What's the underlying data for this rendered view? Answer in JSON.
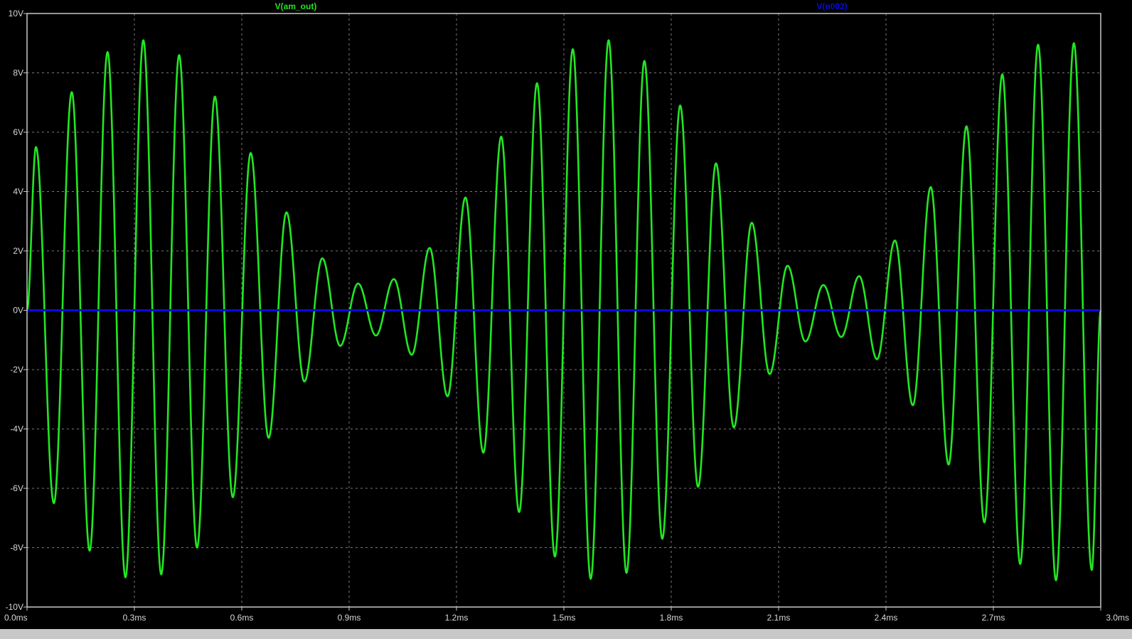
{
  "colors": {
    "background": "#000000",
    "frame": "#c8c8c8",
    "grid": "#7a7a7a",
    "tick_text": "#d8d8d8",
    "am_out": "#22e622",
    "n002": "#0a0ad8"
  },
  "chart_data": {
    "type": "line",
    "title": "",
    "xlabel": "",
    "ylabel": "",
    "xlim": [
      0.0,
      3.0
    ],
    "ylim": [
      -10,
      10
    ],
    "grid": true,
    "x_ticks": [
      0.0,
      0.3,
      0.6,
      0.9,
      1.2,
      1.5,
      1.8,
      2.1,
      2.4,
      2.7,
      3.0
    ],
    "x_tick_labels": [
      "0.0ms",
      "0.3ms",
      "0.6ms",
      "0.9ms",
      "1.2ms",
      "1.5ms",
      "1.8ms",
      "2.1ms",
      "2.4ms",
      "2.7ms",
      "3.0ms"
    ],
    "y_ticks": [
      10,
      8,
      6,
      4,
      2,
      0,
      -2,
      -4,
      -6,
      -8,
      -10
    ],
    "y_tick_labels": [
      "10V",
      "8V",
      "6V",
      "4V",
      "2V",
      "0V",
      "-2V",
      "-4V",
      "-6V",
      "-8V",
      "-10V"
    ],
    "series": [
      {
        "name": "V(am_out)",
        "color": "#22e622",
        "x": [
          0.0,
          0.025,
          0.075,
          0.125,
          0.175,
          0.225,
          0.275,
          0.325,
          0.375,
          0.425,
          0.475,
          0.525,
          0.575,
          0.625,
          0.675,
          0.725,
          0.775,
          0.825,
          0.875,
          0.925,
          0.975,
          1.025,
          1.075,
          1.125,
          1.175,
          1.225,
          1.275,
          1.325,
          1.375,
          1.425,
          1.475,
          1.525,
          1.575,
          1.625,
          1.675,
          1.725,
          1.775,
          1.825,
          1.875,
          1.925,
          1.975,
          2.025,
          2.075,
          2.125,
          2.175,
          2.225,
          2.275,
          2.325,
          2.375,
          2.425,
          2.475,
          2.525,
          2.575,
          2.625,
          2.675,
          2.725,
          2.775,
          2.825,
          2.875,
          2.925,
          2.975,
          3.0
        ],
        "y": [
          0.0,
          5.5,
          -6.5,
          7.35,
          -8.1,
          8.7,
          -9.0,
          9.1,
          -8.9,
          8.6,
          -8.0,
          7.2,
          -6.3,
          5.3,
          -4.3,
          3.3,
          -2.4,
          1.75,
          -1.2,
          0.9,
          -0.85,
          1.05,
          -1.5,
          2.1,
          -2.9,
          3.8,
          -4.8,
          5.85,
          -6.8,
          7.65,
          -8.3,
          8.8,
          -9.05,
          9.1,
          -8.85,
          8.4,
          -7.7,
          6.9,
          -5.95,
          4.95,
          -3.95,
          2.95,
          -2.15,
          1.5,
          -1.05,
          0.85,
          -0.9,
          1.15,
          -1.65,
          2.35,
          -3.2,
          4.15,
          -5.2,
          6.2,
          -7.15,
          7.95,
          -8.55,
          8.95,
          -9.1,
          9.0,
          -8.75,
          0.0
        ]
      },
      {
        "name": "V(n002)",
        "color": "#0a0ad8",
        "x": [
          0.0,
          3.0
        ],
        "y": [
          0.0,
          0.0
        ]
      }
    ]
  }
}
